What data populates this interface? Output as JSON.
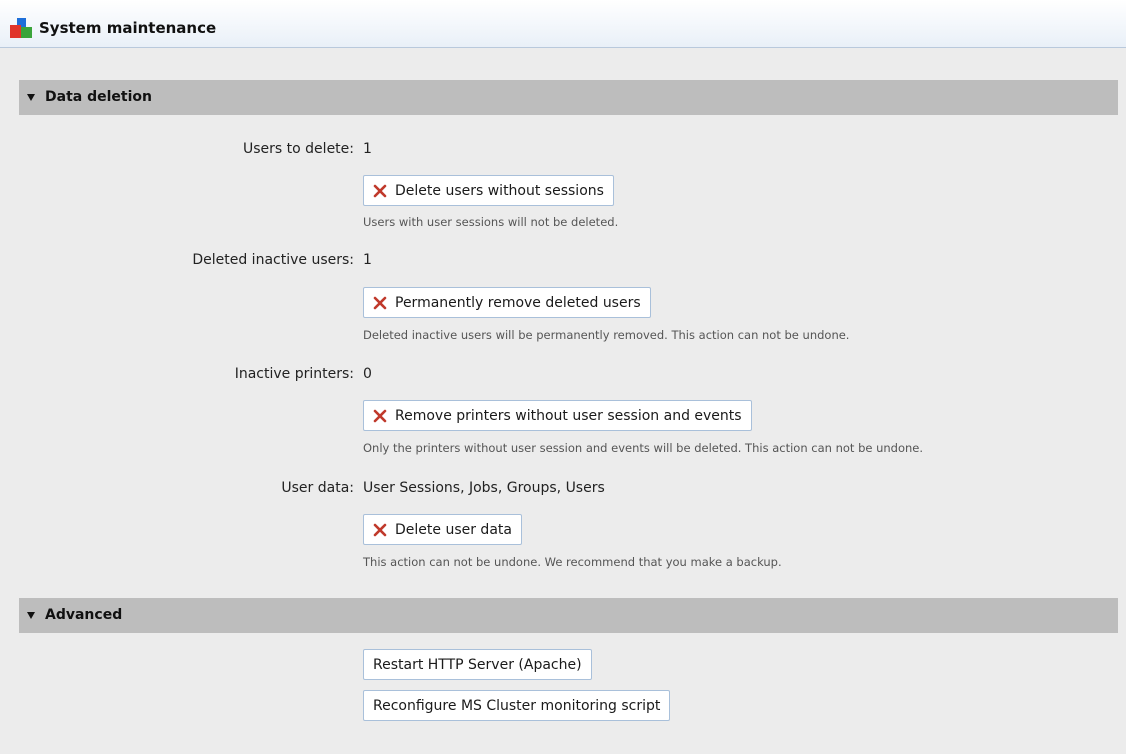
{
  "window": {
    "title": "System maintenance",
    "icon": "system-maintenance-icon"
  },
  "sections": [
    {
      "label": "Data deletion",
      "icon": "triangle-down-icon",
      "expanded": true
    },
    {
      "label": "Advanced",
      "icon": "triangle-down-icon",
      "expanded": true
    }
  ],
  "data_deletion": {
    "users_to_delete": {
      "label": "Users to delete:",
      "value": "1",
      "button": "Delete users without sessions",
      "note": "Users with user sessions will not be deleted."
    },
    "deleted_inactive_users": {
      "label": "Deleted inactive users:",
      "value": "1",
      "button": "Permanently remove deleted users",
      "note": "Deleted inactive users will be permanently removed. This action can not be undone."
    },
    "inactive_printers": {
      "label": "Inactive printers:",
      "value": "0",
      "button": "Remove printers without user session and events",
      "note": "Only the printers without user session and events will be deleted. This action can not be undone."
    },
    "user_data": {
      "label": "User data:",
      "value": "User Sessions, Jobs, Groups, Users",
      "button": "Delete user data",
      "note": "This action can not be undone. We recommend that you make a backup."
    }
  },
  "advanced": {
    "restart_button": "Restart HTTP Server (Apache)",
    "reconfigure_button": "Reconfigure MS Cluster monitoring script"
  },
  "colors": {
    "delete_icon": "#c0392b",
    "section_header": "#bdbdbd",
    "button_border": "#a9c0da"
  }
}
